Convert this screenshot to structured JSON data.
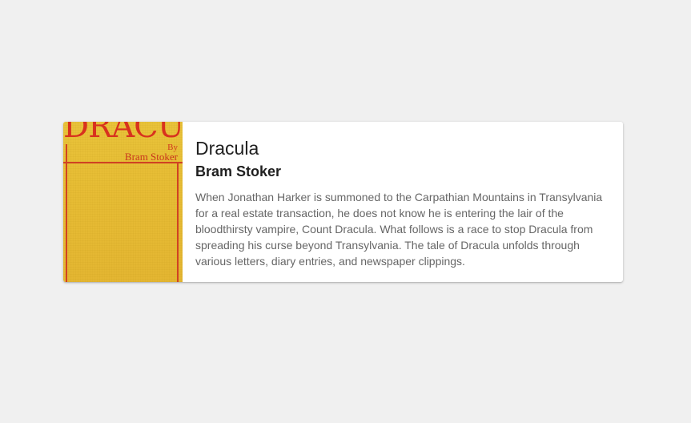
{
  "book": {
    "cover": {
      "title_text": "DRACULA",
      "by_text": "By",
      "author_text": "Bram Stoker"
    },
    "title": "Dracula",
    "author": "Bram Stoker",
    "description": "When Jonathan Harker is summoned to the Carpathian Mountains in Transylvania for a real estate transaction, he does not know he is entering the lair of the bloodthirsty vampire, Count Dracula. What follows is a race to stop Dracula from spreading his curse beyond Transylvania. The tale of Dracula unfolds through various letters, diary entries, and newspaper clippings."
  },
  "colors": {
    "page_background": "#f0f0f0",
    "card_background": "#ffffff",
    "cover_yellow": "#e7bd35",
    "cover_red": "#d8321e"
  }
}
